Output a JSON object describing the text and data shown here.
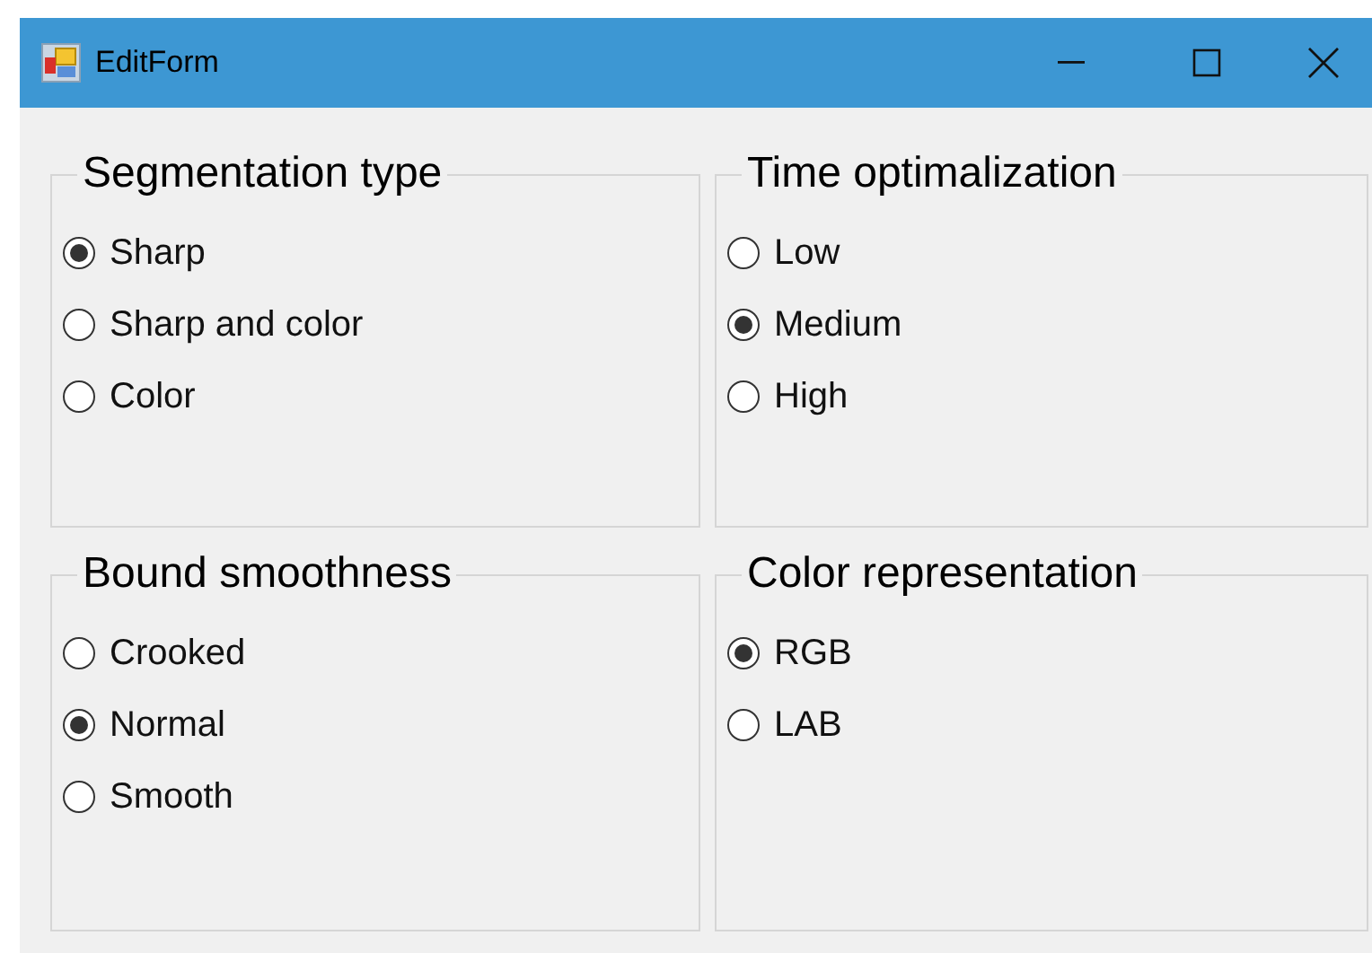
{
  "window": {
    "title": "EditForm"
  },
  "groups": [
    {
      "title": "Segmentation type",
      "options": [
        {
          "label": "Sharp",
          "selected": true
        },
        {
          "label": "Sharp and color",
          "selected": false
        },
        {
          "label": "Color",
          "selected": false
        }
      ]
    },
    {
      "title": "Time optimalization",
      "options": [
        {
          "label": "Low",
          "selected": false
        },
        {
          "label": "Medium",
          "selected": true
        },
        {
          "label": "High",
          "selected": false
        }
      ]
    },
    {
      "title": "Bound smoothness",
      "options": [
        {
          "label": "Crooked",
          "selected": false
        },
        {
          "label": "Normal",
          "selected": true
        },
        {
          "label": "Smooth",
          "selected": false
        }
      ]
    },
    {
      "title": "Color representation",
      "options": [
        {
          "label": "RGB",
          "selected": true
        },
        {
          "label": "LAB",
          "selected": false
        }
      ]
    }
  ]
}
